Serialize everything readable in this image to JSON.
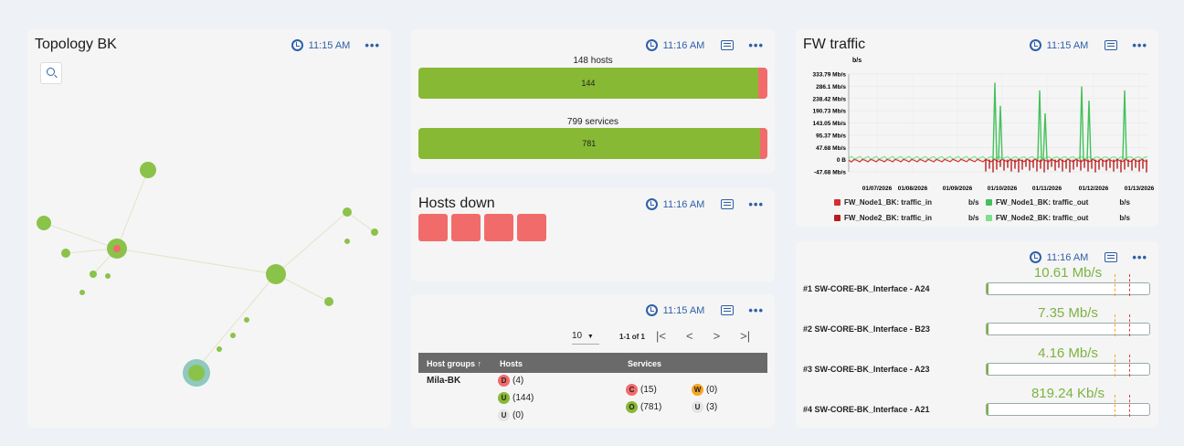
{
  "topology": {
    "title": "Topology BK",
    "time": "11:15 AM"
  },
  "status": {
    "time": "11:16 AM",
    "hosts": {
      "title": "148 hosts",
      "ok_label": "144",
      "ok_fraction": 0.973
    },
    "services": {
      "title": "799 services",
      "ok_label": "781",
      "ok_fraction": 0.978
    }
  },
  "hosts_down": {
    "title": "Hosts down",
    "time": "11:16 AM",
    "count": 4
  },
  "host_groups": {
    "time": "11:15 AM",
    "page_size": "10",
    "pagination": "1-1 of 1",
    "columns": {
      "group": "Host groups",
      "hosts": "Hosts",
      "services": "Services"
    },
    "row": {
      "name": "Mila-BK",
      "hosts": [
        {
          "s": "D",
          "v": "(4)"
        },
        {
          "s": "U",
          "v": "(144)"
        },
        {
          "s": "U",
          "v": "(0)"
        }
      ],
      "services": [
        {
          "s": "C",
          "v": "(15)"
        },
        {
          "s": "W",
          "v": "(0)"
        },
        {
          "s": "O",
          "v": "(781)"
        },
        {
          "s": "U",
          "v": "(3)"
        }
      ]
    }
  },
  "fw_traffic": {
    "title": "FW traffic",
    "time": "11:15 AM"
  },
  "chart_data": {
    "type": "line",
    "title": "FW traffic",
    "ylabel": "b/s",
    "y_ticks": [
      "333.79 Mb/s",
      "286.1 Mb/s",
      "238.42 Mb/s",
      "190.73 Mb/s",
      "143.05 Mb/s",
      "95.37 Mb/s",
      "47.68 Mb/s",
      "0 B",
      "-47.68 Mb/s"
    ],
    "x_ticks": [
      "01/07/2026",
      "01/08/2026",
      "01/09/2026",
      "01/10/2026",
      "01/11/2026",
      "01/12/2026",
      "01/13/2026"
    ],
    "ylim": [
      -47.68,
      333.79
    ],
    "series": [
      {
        "name": "FW_Node1_BK: traffic_in",
        "unit": "b/s",
        "color": "#d32f2f"
      },
      {
        "name": "FW_Node1_BK: traffic_out",
        "unit": "b/s",
        "color": "#43c15a"
      },
      {
        "name": "FW_Node2_BK: traffic_in",
        "unit": "b/s",
        "color": "#b71c1c"
      },
      {
        "name": "FW_Node2_BK: traffic_out",
        "unit": "b/s",
        "color": "#7ee08a"
      }
    ],
    "out_spikes": [
      {
        "x": "01/10/2026",
        "y": 300
      },
      {
        "x": "01/10/2026",
        "y": 210
      },
      {
        "x": "01/11/2026",
        "y": 270
      },
      {
        "x": "01/11/2026",
        "y": 180
      },
      {
        "x": "01/12/2026",
        "y": 285
      },
      {
        "x": "01/12/2026",
        "y": 230
      },
      {
        "x": "01/13/2026",
        "y": 270
      }
    ]
  },
  "interfaces": {
    "time": "11:16 AM",
    "items": [
      {
        "name": "#1 SW-CORE-BK_Interface - A24",
        "value": "10.61 Mb/s",
        "fraction": 0.0
      },
      {
        "name": "#2 SW-CORE-BK_Interface - B23",
        "value": "7.35 Mb/s",
        "fraction": 0.01
      },
      {
        "name": "#3 SW-CORE-BK_Interface - A23",
        "value": "4.16 Mb/s",
        "fraction": 0.0
      },
      {
        "name": "#4 SW-CORE-BK_Interface - A21",
        "value": "819.24 Kb/s",
        "fraction": 0.0
      }
    ]
  }
}
